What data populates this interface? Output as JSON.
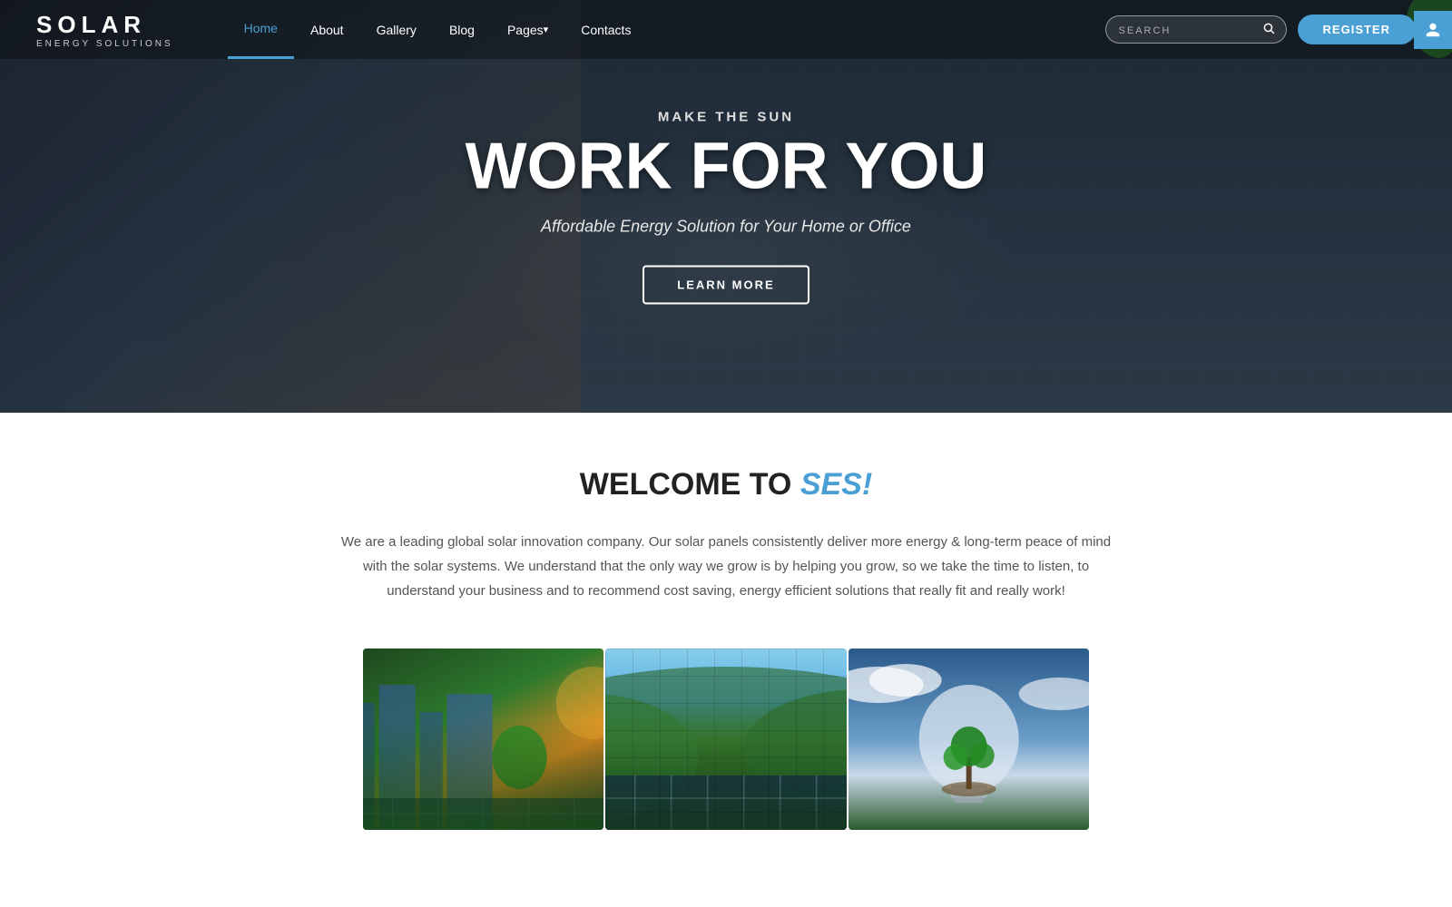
{
  "logo": {
    "name": "SOLAR",
    "tagline": "ENERGY SOLUTIONS"
  },
  "nav": {
    "links": [
      {
        "label": "Home",
        "active": true
      },
      {
        "label": "About",
        "active": false
      },
      {
        "label": "Gallery",
        "active": false
      },
      {
        "label": "Blog",
        "active": false
      },
      {
        "label": "Pages",
        "active": false,
        "hasArrow": true
      },
      {
        "label": "Contacts",
        "active": false
      }
    ],
    "search_placeholder": "SEARCH",
    "register_label": "REGISTER"
  },
  "hero": {
    "subtitle": "MAKE THE SUN",
    "title": "WORK FOR YOU",
    "tagline": "Affordable Energy Solution for Your Home or Office",
    "cta_label": "LEARN MORE"
  },
  "welcome": {
    "title_prefix": "WELCOME TO ",
    "title_brand": "SES!",
    "body": "We are a leading global solar innovation company. Our solar panels consistently deliver more energy & long-term peace of mind with the solar systems. We understand that the only way we grow is by helping you grow, so we take the time to listen, to understand your business and to recommend cost saving, energy efficient solutions that really fit and really work!"
  },
  "gallery": {
    "images": [
      {
        "alt": "City solar panels with skyline"
      },
      {
        "alt": "Solar panels in forest landscape"
      },
      {
        "alt": "Green energy light bulb with tree"
      }
    ]
  },
  "colors": {
    "accent": "#4a9fd4",
    "primary_text": "#222",
    "secondary_text": "#555"
  }
}
